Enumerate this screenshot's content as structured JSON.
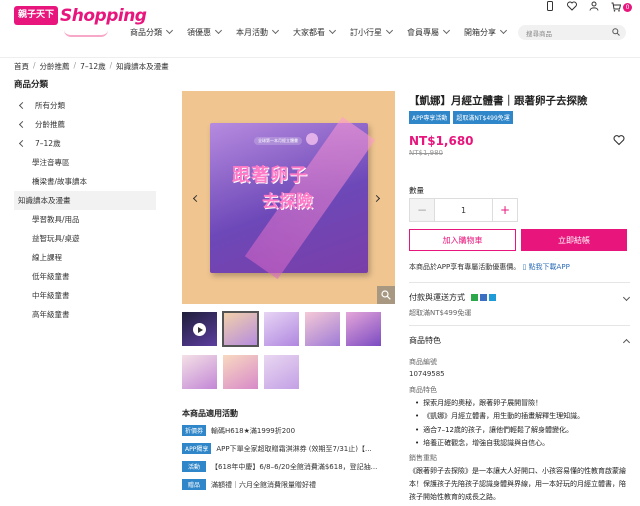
{
  "header": {
    "logo_badge": "親子天下",
    "logo_text": "Shopping",
    "cart_count": "0",
    "nav": [
      "商品分類",
      "領優惠",
      "本月活動",
      "大家都看",
      "訂小行星",
      "會員專屬",
      "開箱分享"
    ],
    "search_placeholder": "搜尋商品"
  },
  "breadcrumb": [
    "首頁",
    "分齡推薦",
    "7–12歲",
    "知識讀本及漫畫"
  ],
  "sidebar": {
    "title": "商品分類",
    "parents": [
      "所有分類",
      "分齡推薦",
      "7–12歲"
    ],
    "children": [
      "學注音專區",
      "橋梁書/故事讀本",
      "知識讀本及漫畫",
      "學習教具/用品",
      "益智玩具/桌遊",
      "線上課程",
      "低年級童書",
      "中年級童書",
      "高年級童書"
    ],
    "active": "知識讀本及漫畫"
  },
  "cover": {
    "tag": "全球第一本月經立體書",
    "title_line1": "跟著卵子",
    "title_line2": "去探險"
  },
  "product": {
    "title": "【凱娜】月經立體書｜跟著卵子去探險",
    "tags": [
      "APP專享活動",
      "超取滿NT$499免運"
    ],
    "price": "NT$1,680",
    "old_price": "NT$1,980",
    "qty_label": "數量",
    "qty": "1",
    "minus": "−",
    "plus": "+",
    "add_cart": "加入購物車",
    "buy_now": "立即結帳",
    "app_note": "本商品於APP享有專屬活動優惠價。",
    "app_link": "點我下載APP"
  },
  "sections": {
    "payment_title": "付款與運送方式",
    "payment_note": "超取滿NT$499免運",
    "features_title": "商品特色",
    "sku_label": "商品編號",
    "sku": "10749585",
    "feature_label": "商品特色",
    "features": [
      "探索月經的奧秘，跟著卵子展開冒險！",
      "《凱娜》月經立體書，用生動的插畫解釋生理知識。",
      "適合7–12歲的孩子，讓他們輕鬆了解身體變化。",
      "培養正確觀念，增強自我認識與自信心。"
    ],
    "selling_label": "銷售重點",
    "description": "《跟著卵子去探險》是一本讓大人好開口、小孩容易懂的性教育啟蒙繪本！保護孩子先陪孩子認識身體與界線，用一本好玩的月經立體書，陪孩子開始性教育的成長之路。"
  },
  "promotions": {
    "title": "本商品適用活動",
    "items": [
      {
        "badge": "折價券",
        "text": "輸碼H618★滿1999折200"
      },
      {
        "badge": "APP獨享",
        "text": "APP下單全家超取贈霜淇淋券 (效期至7/31止)【..."
      },
      {
        "badge": "活動",
        "text": "【618年中慶】6/8–6/20全館消費滿$618，登記抽..."
      },
      {
        "badge": "贈品",
        "text": "滿額禮｜六月全館消費限量贈好禮"
      }
    ]
  },
  "colors": {
    "brand": "#e8157d",
    "tag_blue": "#2f86c9",
    "cover_bg": "#f0c590"
  }
}
